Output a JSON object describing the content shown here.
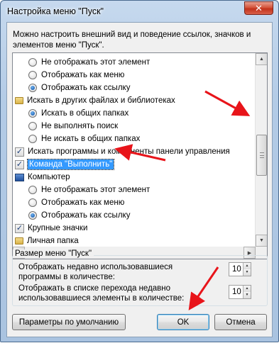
{
  "window": {
    "title": "Настройка меню \"Пуск\"",
    "close_glyph": "✕"
  },
  "description": "Можно настроить внешний вид и поведение ссылок, значков и элементов меню \"Пуск\".",
  "list": {
    "rows": [
      {
        "kind": "radio",
        "checked": false,
        "label": "Не отображать этот элемент"
      },
      {
        "kind": "radio",
        "checked": false,
        "label": "Отображать как меню"
      },
      {
        "kind": "radio",
        "checked": true,
        "label": "Отображать как ссылку"
      },
      {
        "kind": "folder",
        "label": "Искать в других файлах и библиотеках"
      },
      {
        "kind": "radio",
        "checked": true,
        "label": "Искать в общих папках"
      },
      {
        "kind": "radio",
        "checked": false,
        "label": "Не выполнять поиск"
      },
      {
        "kind": "radio",
        "checked": false,
        "label": "Не искать в общих папках"
      },
      {
        "kind": "check",
        "checked": true,
        "label": "Искать программы и компоненты панели управления"
      },
      {
        "kind": "check",
        "checked": true,
        "label": "Команда \"Выполнить\"",
        "selected": true
      },
      {
        "kind": "computer",
        "label": "Компьютер"
      },
      {
        "kind": "radio",
        "checked": false,
        "label": "Не отображать этот элемент"
      },
      {
        "kind": "radio",
        "checked": false,
        "label": "Отображать как меню"
      },
      {
        "kind": "radio",
        "checked": true,
        "label": "Отображать как ссылку"
      },
      {
        "kind": "check",
        "checked": true,
        "label": "Крупные значки"
      },
      {
        "kind": "folder",
        "label": "Личная папка"
      },
      {
        "kind": "radio",
        "checked": false,
        "label": "Не отображать этот элемент"
      }
    ]
  },
  "size_group": {
    "title": "Размер меню \"Пуск\"",
    "recent_programs_label": "Отображать недавно использовавшиеся программы в количестве:",
    "recent_programs_value": "10",
    "jump_list_label": "Отображать в списке перехода недавно использовавшиеся элементы в количестве:",
    "jump_list_value": "10"
  },
  "buttons": {
    "defaults": "Параметры по умолчанию",
    "ok": "OK",
    "cancel": "Отмена"
  },
  "colors": {
    "selection": "#3399ff",
    "arrow": "#e8141a"
  }
}
